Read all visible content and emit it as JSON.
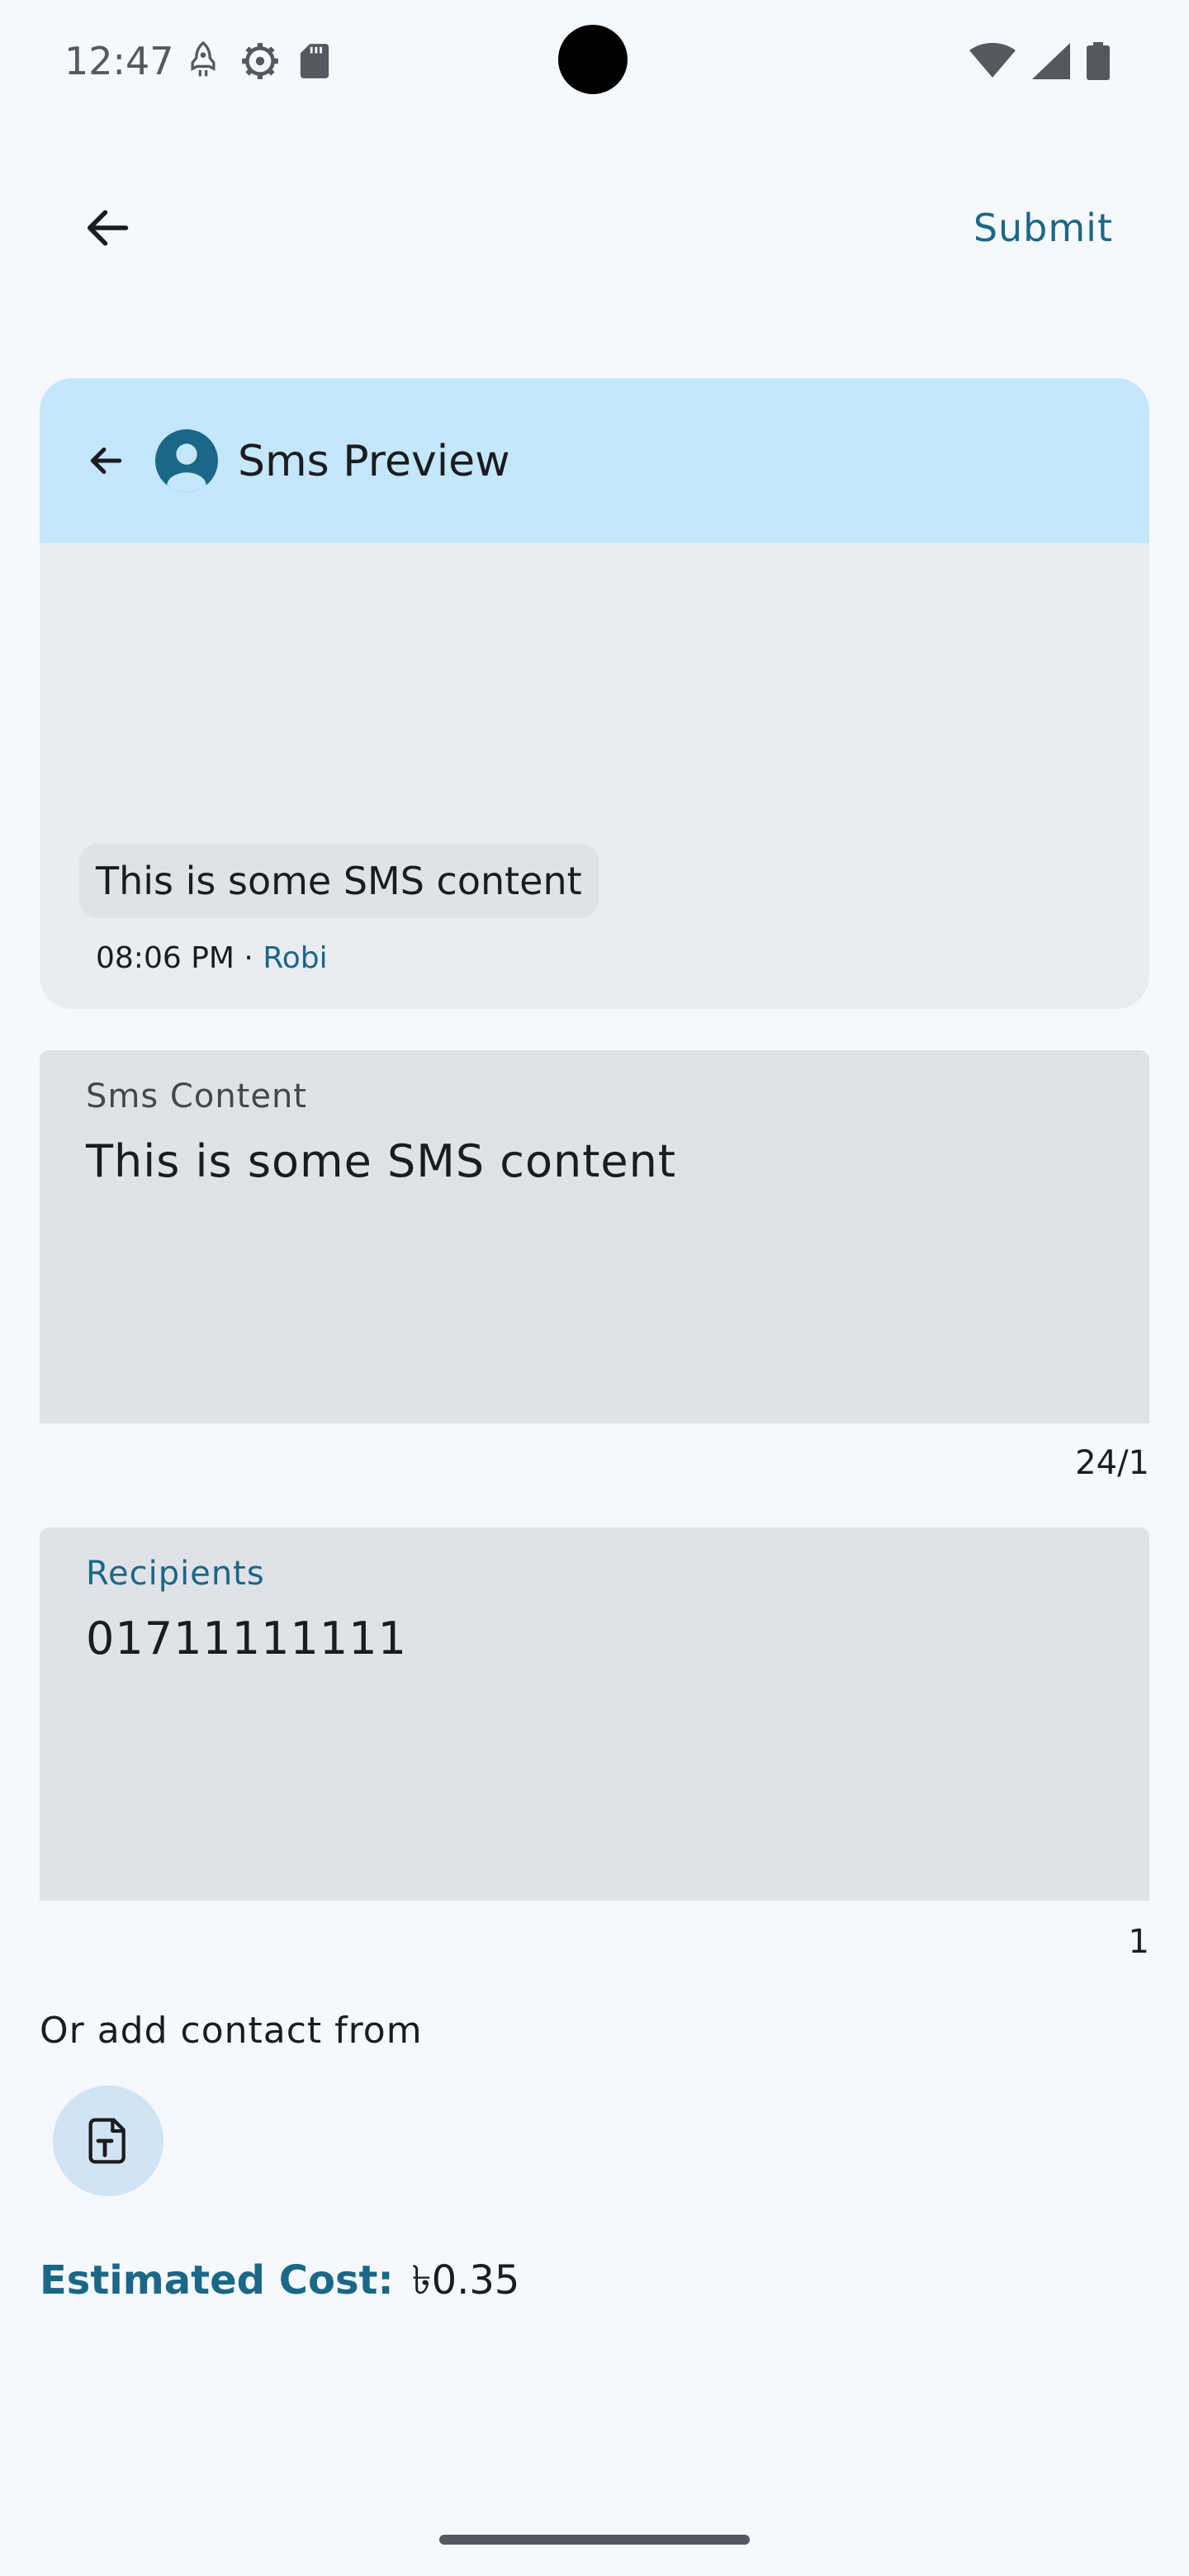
{
  "status_bar": {
    "time": "12:47",
    "left_icons": [
      "rocket-icon",
      "gear-icon",
      "sd-card-icon"
    ],
    "right_icons": [
      "wifi-icon",
      "signal-icon",
      "battery-icon"
    ]
  },
  "app_bar": {
    "back_icon": "arrow-back-icon",
    "submit_label": "Submit"
  },
  "preview": {
    "title": "Sms Preview",
    "back_icon": "arrow-back-icon",
    "avatar_icon": "account-circle-icon",
    "message": "This is some SMS content",
    "time": "08:06 PM",
    "separator": " · ",
    "sender": "Robi"
  },
  "sms_field": {
    "label": "Sms Content",
    "value": "This is some SMS content",
    "counter": "24/1"
  },
  "recipients_field": {
    "label": "Recipients",
    "value": "01711111111",
    "counter": "1"
  },
  "contacts": {
    "label": "Or add contact from",
    "file_button_icon": "text-file-icon"
  },
  "cost": {
    "label": "Estimated Cost:",
    "value": "৳0.35"
  },
  "colors": {
    "accent": "#1b6787",
    "header_bg": "#c4e7fb",
    "page_bg": "#f5f8fc",
    "field_bg": "#dfe2e7"
  }
}
